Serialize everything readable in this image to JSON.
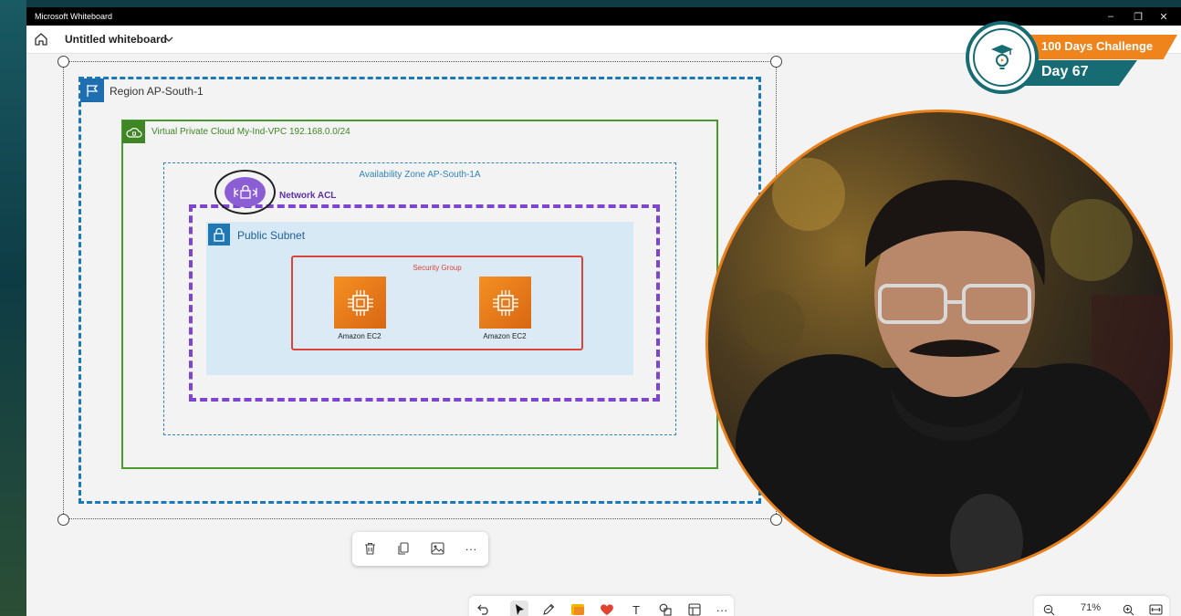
{
  "window": {
    "title": "Microsoft Whiteboard",
    "controls": [
      "–",
      "❐",
      "✕"
    ]
  },
  "appbar": {
    "board_title": "Untitled whiteboard"
  },
  "diagram": {
    "region_label": "Region AP-South-1",
    "vpc_label": "Virtual Private Cloud My-Ind-VPC 192.168.0.0/24",
    "az_label": "Availability Zone AP-South-1A",
    "nacl_label": "Network ACL",
    "subnet_label": "Public Subnet",
    "security_group_label": "Security Group",
    "instances": [
      {
        "label": "Amazon EC2"
      },
      {
        "label": "Amazon EC2"
      }
    ],
    "colors": {
      "region": "#1c79b8",
      "vpc": "#4a9b2e",
      "az": "#2f85bd",
      "nacl": "#7d45d0",
      "subnet_fill": "#d7e9f5",
      "security_group": "#d9453b",
      "ec2": "#e57a19"
    }
  },
  "context_toolbar": {
    "buttons": [
      "trash-icon",
      "copy-icon",
      "image-icon",
      "more-icon"
    ],
    "more_label": "···"
  },
  "bottom_toolbar": {
    "tools": [
      "undo-icon",
      "select-icon",
      "pen-icon",
      "sticky-note-icon",
      "reaction-icon",
      "text-icon",
      "shapes-icon",
      "template-icon",
      "more-icon"
    ],
    "more_label": "···",
    "text_tool_label": "T"
  },
  "zoom": {
    "level": "71%"
  },
  "badge": {
    "line1": "100 Days Challenge",
    "line2": "Day 67",
    "colors": {
      "orange": "#f0841c",
      "teal": "#176b73"
    }
  }
}
